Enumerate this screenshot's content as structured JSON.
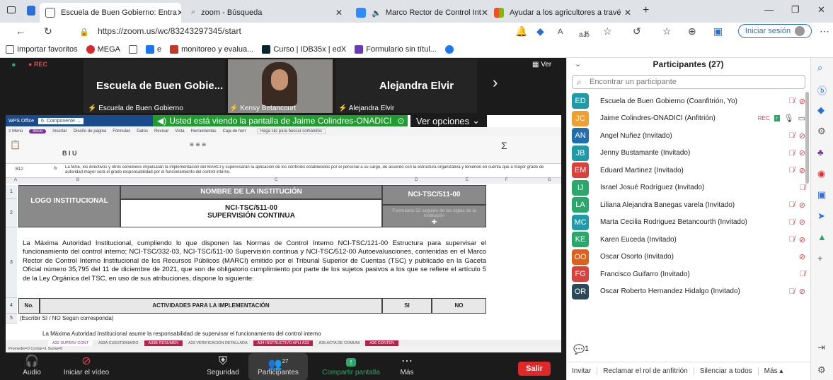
{
  "browser": {
    "tabs": [
      {
        "label": "Escuela de Buen Gobierno: Entra",
        "color": "#2b6fd8"
      },
      {
        "label": "zoom - Búsqueda",
        "color": "#888888"
      },
      {
        "label": "Marco Rector de Control Int",
        "color": "#2d8cff"
      },
      {
        "label": "Ayudar a los agricultores a travé",
        "color": "#f4b400"
      }
    ],
    "new_tab": "+",
    "url": "https://zoom.us/wc/83243297345/start",
    "login": "Iniciar sesión",
    "favorites": [
      "Importar favoritos",
      "MEGA",
      "e",
      "monitoreo y evalua...",
      "Curso | IDB35x | edX",
      "Formulario sin títul..."
    ]
  },
  "zoom": {
    "rec": "REC",
    "ver": "Ver",
    "tiles": [
      {
        "name": "Escuela de Buen Gobie...",
        "sub": "Escuela de Buen Gobierno"
      },
      {
        "name": "",
        "sub": "Kensy Betancourt"
      },
      {
        "name": "Alejandra Elvir",
        "sub": "Alejandra Elvir"
      }
    ],
    "share_banner": "Usted está viendo la pantalla de Jaime Colindres-ONADICI",
    "view_options": "Ver opciones",
    "toolbar": [
      {
        "label": "Audio"
      },
      {
        "label": "Iniciar el vídeo"
      },
      {
        "label": "Seguridad"
      },
      {
        "label": "Participantes",
        "count": "27"
      },
      {
        "label": "Compartir pantalla"
      },
      {
        "label": "Más"
      }
    ],
    "leave": "Salir"
  },
  "wps": {
    "tabs": [
      "WPS Office",
      "6. Componente ..."
    ],
    "menu": [
      "≡ Menú",
      "Inicio",
      "Insertar",
      "Diseño de página",
      "Fórmulas",
      "Datos",
      "Revisar",
      "Vista",
      "Herramientas",
      "Caja de herr"
    ],
    "search": "Haga clic para buscar comandos",
    "cell_ref": "B12",
    "formula": "La MAE, los directivos y otros servidores impulsarán la implementación del MARCI y supervisarán la aplicación de los controles establecidos por el personal a su cargo, de acuerdo con la estructura organizativa y teniendo en cuenta que a mayor grado de autoridad mayor será el grado responsabilidad por el funcionamiento del control interno.",
    "columns": [
      "A",
      "B",
      "C",
      "D",
      "E",
      "F",
      "G"
    ],
    "rows": [
      "1",
      "2",
      "3",
      "4",
      "5"
    ],
    "logo": "LOGO INSTITUCIONAL",
    "institution": "NOMBRE DE LA INSTITUCIÓN",
    "code_title": "NCI-TSC/511-00",
    "subtitle": "SUPERVISIÓN CONTINUA",
    "code_right": "NCI-TSC/511-00",
    "form_note": "Formulario 52 seguido de las siglas de la institución",
    "body": "La Máxima Autoridad Institucional, cumpliendo lo que disponen las Normas de Control Interno NCI-TSC/121-00 Estructura para supervisar el funcionamiento del control interno; NCI-TSC/332-03, NCI-TSC/511-00 Supervisión continua y NCI-TSC/512-00 Autoevaluaciones, contenidas en el Marco Rector de Control Interno Institucional de los Recursos Públicos (MARCI) emitido por el Tribunal Superior de Cuentas (TSC) y publicado en la Gaceta Oficial número 35,795 del 11 de diciembre de 2021, que son de obligatorio cumplimiento por parte de los sujetos pasivos a los que se refiere el artículo 5 de la Ley Orgánica del TSC, en uso de sus atribuciones, dispone lo siguiente:",
    "table_head": {
      "no": "No.",
      "activities": "ACTIVIDADES PARA LA IMPLEMENTACIÓN",
      "si": "SI",
      "no_col": "NO"
    },
    "row5": "(Escribir SI / NO Según corresponda)",
    "row6": "La Máxima Autoridad Institucional asume la responsabilidad de supervisar el funcionamiento del control interno",
    "sheet_tabs": [
      "A32 SUPERV CONT",
      "A33A CUESTIONARIO",
      "A33B RESUMEN",
      "A33 VERIFICACION DETALLADA",
      "A34 INSTRUCTIVO APLI A33",
      "A35 ACTA DE COMUNI",
      "A36 CONTEN"
    ],
    "status": "Promedio=0  Contar=1  Suma=0"
  },
  "panel": {
    "title": "Participantes (27)",
    "search_placeholder": "Encontrar un participante",
    "participants": [
      {
        "initials": "ED",
        "name": "Escuela de Buen Gobierno (Coanfitrión, Yo)",
        "color": "#1f9aa8"
      },
      {
        "initials": "JC",
        "name": "Jaime Colindres-ONADICI (Anfitrión)",
        "color": "#f0a030"
      },
      {
        "initials": "AN",
        "name": "Angel Nuñez (Invitado)",
        "color": "#1f6fb0"
      },
      {
        "initials": "JB",
        "name": "Jenny Bustamante (Invitado)",
        "color": "#1f9aa8"
      },
      {
        "initials": "EM",
        "name": "Eduard Martinez (Invitado)",
        "color": "#d9413a"
      },
      {
        "initials": "IJ",
        "name": "Israel Josué Rodríguez (Invitado)",
        "color": "#2aa76a"
      },
      {
        "initials": "LA",
        "name": "Liliana Alejandra Banegas varela (Invitado)",
        "color": "#2aa76a"
      },
      {
        "initials": "MC",
        "name": "Marta Cecilia Rodriguez Betancourth (Invitado)",
        "color": "#1f9aa8"
      },
      {
        "initials": "KE",
        "name": "Karen Euceda (Invitado)",
        "color": "#2aa76a"
      },
      {
        "initials": "OO",
        "name": "Oscar Osorto (Invitado)",
        "color": "#e0601a"
      },
      {
        "initials": "FG",
        "name": "Francisco Guifarro (Invitado)",
        "color": "#d9413a"
      },
      {
        "initials": "OR",
        "name": "Oscar Roberto Hernandez Hidalgo (Invitado)",
        "color": "#2a4a5a"
      }
    ],
    "host_rec": "REC",
    "count": "1",
    "footer": [
      "Invitar",
      "Reclamar el rol de anfitrión",
      "Silenciar a todos",
      "Más ▴"
    ]
  }
}
